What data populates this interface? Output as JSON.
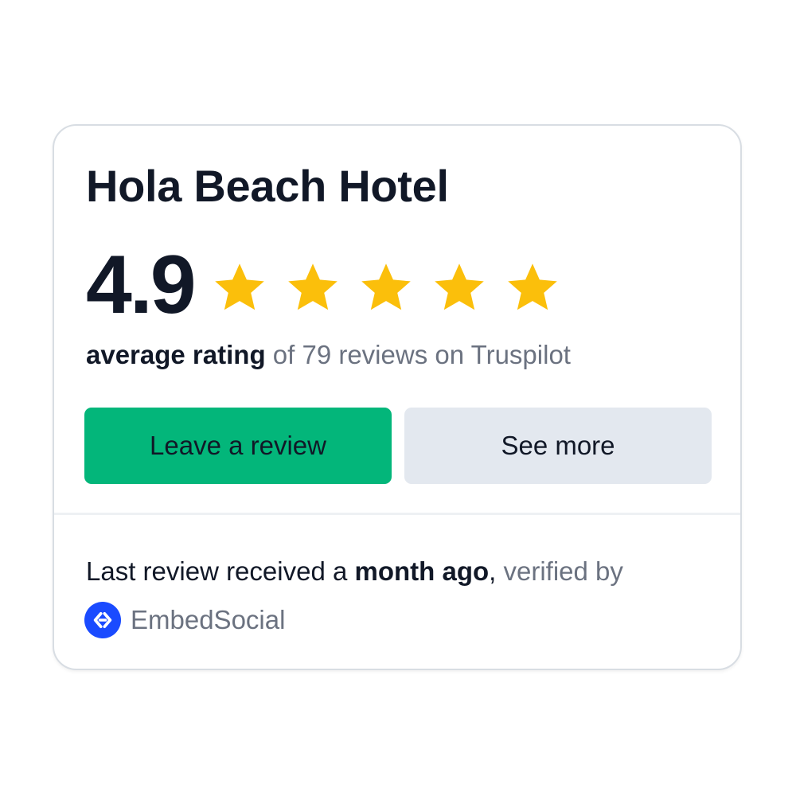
{
  "widget": {
    "title": "Hola Beach Hotel",
    "rating": "4.9",
    "stars_filled": 5,
    "stars_total": 5,
    "star_color": "#fbbf0b",
    "summary_bold": "average rating",
    "summary_rest": " of 79 reviews on Truspilot"
  },
  "buttons": {
    "leave_review_label": "Leave a review",
    "see_more_label": "See more",
    "primary_color": "#03b67a",
    "secondary_color": "#e3e8ef"
  },
  "footer": {
    "prefix": "Last review received a ",
    "bold": "month ago",
    "comma": ",",
    "suffix": " verified by",
    "brand_name": "EmbedSocial",
    "brand_icon": "embedsocial-logo-icon",
    "brand_color": "#1a4bff"
  }
}
